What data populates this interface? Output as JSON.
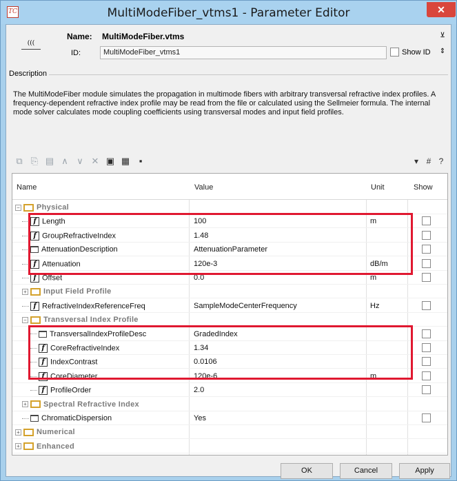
{
  "window": {
    "title": "MultiModeFiber_vtms1 - Parameter Editor",
    "app_icon_text": "TC",
    "close_glyph": "✕"
  },
  "header": {
    "module_icon_text": "(((",
    "name_label": "Name:",
    "name_value": "MultiModeFiber.vtms",
    "id_label": "ID:",
    "id_value": "MultiModeFiber_vtms1",
    "show_id_label": "Show ID"
  },
  "description": {
    "title": "Description",
    "text": "The MultiModeFiber module simulates the propagation in multimode fibers with arbitrary transversal refractive index profiles. A frequency-dependent refractive index profile may be read from the file or calculated using the Sellmeier formula. The internal mode solver calculates mode coupling coefficients using transversal modes and input field profiles."
  },
  "toolbar": {
    "icons": [
      "copy-icon",
      "paste-icon",
      "folder-open-icon",
      "move-up-icon",
      "move-down-icon",
      "delete-icon",
      "document-icon",
      "image-icon",
      "save-icon"
    ],
    "right_icons": [
      "filter-icon",
      "grid-icon",
      "help-icon"
    ]
  },
  "grid": {
    "columns": [
      "Name",
      "Value",
      "Unit",
      "Show"
    ],
    "rows": [
      {
        "kind": "group",
        "name": "Physical",
        "expanded": true
      },
      {
        "kind": "param",
        "icon": "f",
        "name": "Length",
        "value": "100",
        "unit": "m"
      },
      {
        "kind": "param",
        "icon": "f",
        "name": "GroupRefractiveIndex",
        "value": "1.48",
        "unit": ""
      },
      {
        "kind": "param",
        "icon": "folder",
        "name": "AttenuationDescription",
        "value": "AttenuationParameter",
        "unit": ""
      },
      {
        "kind": "param",
        "icon": "f",
        "name": "Attenuation",
        "value": "120e-3",
        "unit": "dB/m"
      },
      {
        "kind": "param",
        "icon": "f",
        "name": "Offset",
        "value": "0.0",
        "unit": "m"
      },
      {
        "kind": "subgroup",
        "name": "Input Field Profile",
        "expanded": false
      },
      {
        "kind": "param",
        "icon": "f",
        "name": "RefractiveIndexReferenceFreq",
        "value": "SampleModeCenterFrequency",
        "unit": "Hz"
      },
      {
        "kind": "subgroup",
        "name": "Transversal Index Profile",
        "expanded": true
      },
      {
        "kind": "param2",
        "icon": "folder",
        "name": "TransversalIndexProfileDesc",
        "value": "GradedIndex",
        "unit": ""
      },
      {
        "kind": "param2",
        "icon": "f",
        "name": "CoreRefractiveIndex",
        "value": "1.34",
        "unit": ""
      },
      {
        "kind": "param2",
        "icon": "f",
        "name": "IndexContrast",
        "value": "0.0106",
        "unit": ""
      },
      {
        "kind": "param2",
        "icon": "f",
        "name": "CoreDiameter",
        "value": "120e-6",
        "unit": "m"
      },
      {
        "kind": "param2",
        "icon": "f",
        "name": "ProfileOrder",
        "value": "2.0",
        "unit": ""
      },
      {
        "kind": "subgroup",
        "name": "Spectral Refractive Index",
        "expanded": false
      },
      {
        "kind": "param",
        "icon": "folder",
        "name": "ChromaticDispersion",
        "value": "Yes",
        "unit": ""
      },
      {
        "kind": "group",
        "name": "Numerical",
        "expanded": false
      },
      {
        "kind": "group",
        "name": "Enhanced",
        "expanded": false
      }
    ]
  },
  "buttons": {
    "ok": "OK",
    "cancel": "Cancel",
    "apply": "Apply"
  },
  "colors": {
    "titlebar": "#a9d2ef",
    "highlight": "#e01830",
    "close": "#d9463c"
  }
}
